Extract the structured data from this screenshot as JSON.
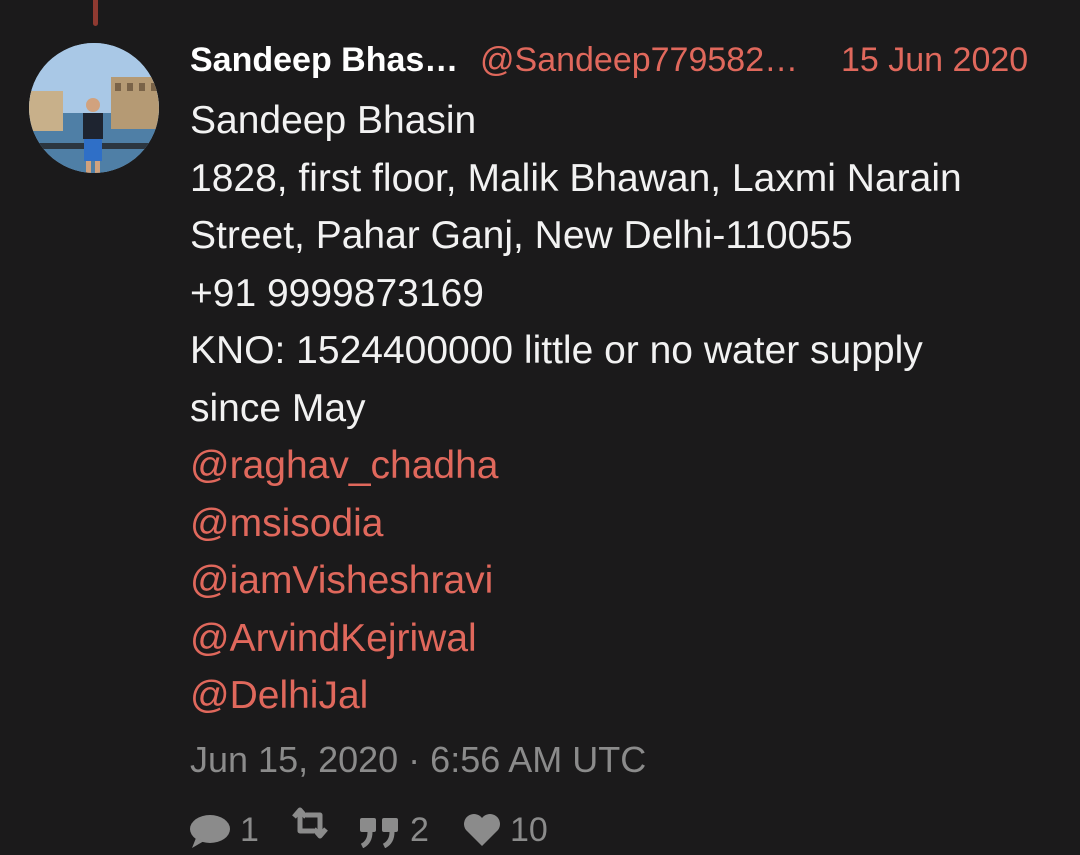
{
  "tweet": {
    "author": {
      "display_name": "Sandeep Bhas…",
      "handle": "@Sandeep779582…"
    },
    "date_short": "15 Jun 2020",
    "body_lines": [
      "Sandeep Bhasin",
      "1828, first floor, Malik Bhawan, Laxmi Narain",
      "Street, Pahar Ganj, New Delhi-110055",
      "+91 9999873169",
      "KNO: 1524400000  little or no water supply",
      "since May"
    ],
    "mentions": [
      "@raghav_chadha",
      "@msisodia",
      "@iamVisheshravi",
      "@ArvindKejriwal",
      "@DelhiJal"
    ],
    "timestamp": "Jun 15, 2020 · 6:56 AM UTC",
    "stats": {
      "replies": "1",
      "retweets": "",
      "quotes": "2",
      "likes": "10"
    }
  },
  "colors": {
    "background": "#1b1a1b",
    "accent": "#e0685c",
    "muted": "#8b8b8b",
    "thread_line": "#8f3a31"
  },
  "icons": {
    "reply": "comment-icon",
    "retweet": "retweet-icon",
    "quote": "quote-icon",
    "like": "heart-icon"
  }
}
